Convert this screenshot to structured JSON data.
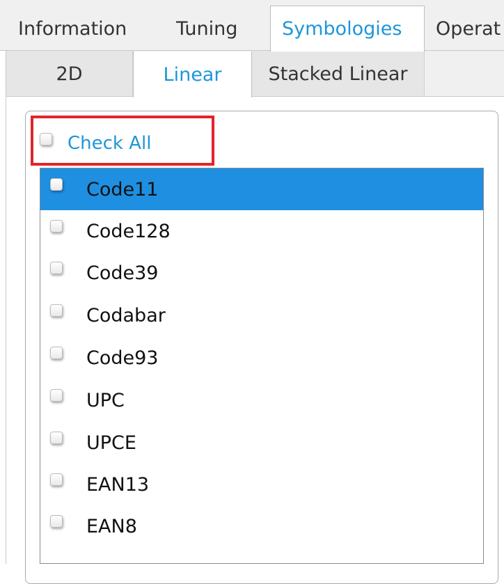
{
  "top_tabs": [
    {
      "label": "Information",
      "active": false
    },
    {
      "label": "Tuning",
      "active": false
    },
    {
      "label": "Symbologies",
      "active": true
    },
    {
      "label": "Operat",
      "active": false
    }
  ],
  "inner_tabs": [
    {
      "label": "2D",
      "active": false
    },
    {
      "label": "Linear",
      "active": true
    },
    {
      "label": "Stacked Linear",
      "active": false
    }
  ],
  "check_all": {
    "label": "Check All",
    "checked": false
  },
  "symbologies": [
    {
      "label": "Code11",
      "checked": false,
      "selected": true
    },
    {
      "label": "Code128",
      "checked": false,
      "selected": false
    },
    {
      "label": "Code39",
      "checked": false,
      "selected": false
    },
    {
      "label": "Codabar",
      "checked": false,
      "selected": false
    },
    {
      "label": "Code93",
      "checked": false,
      "selected": false
    },
    {
      "label": "UPC",
      "checked": false,
      "selected": false
    },
    {
      "label": "UPCE",
      "checked": false,
      "selected": false
    },
    {
      "label": "EAN13",
      "checked": false,
      "selected": false
    },
    {
      "label": "EAN8",
      "checked": false,
      "selected": false
    }
  ],
  "colors": {
    "accent": "#1e96d8",
    "selection": "#1e8fe1",
    "highlight": "#e0242c",
    "tab_bar": "#f0f0f0"
  }
}
